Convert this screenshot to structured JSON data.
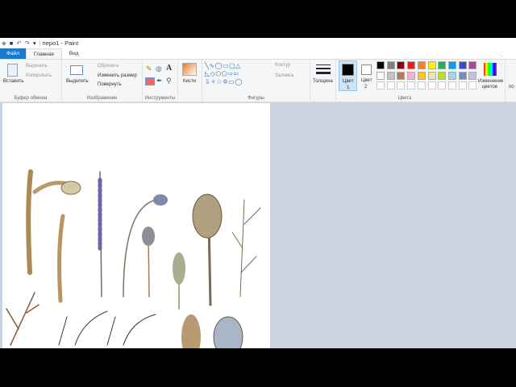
{
  "title": "перо1 - Paint",
  "tabs": [
    "Файл",
    "Главная",
    "Вид"
  ],
  "clipboard": {
    "paste": "Вставить",
    "cut": "Вырезать",
    "copy": "Копировать",
    "label": "Буфер обмена"
  },
  "image": {
    "select": "Выделить",
    "crop": "Обрезать",
    "resize": "Изменить размер",
    "rotate": "Повернуть",
    "label": "Изображение"
  },
  "tools": {
    "label": "Инструменты"
  },
  "brushes": {
    "label": "Кисти"
  },
  "shapes": {
    "outline": "Контур",
    "fill": "Заливка",
    "label": "Фигуры"
  },
  "size": {
    "label": "Толщина"
  },
  "colors": {
    "color1": "Цвет",
    "color1_num": "1",
    "color2": "Цвет",
    "color2_num": "2",
    "label": "Цвета",
    "edit": "Изменение",
    "edit2": "цветов",
    "cut_off": "по",
    "row1": [
      "#000000",
      "#7f7f7f",
      "#880015",
      "#ed1c24",
      "#ff7f27",
      "#fff200",
      "#22b14c",
      "#00a2e8",
      "#3f48cc",
      "#a349a4"
    ],
    "row2": [
      "#ffffff",
      "#c3c3c3",
      "#b97a57",
      "#ffaec9",
      "#ffc90e",
      "#efe4b0",
      "#b5e61d",
      "#99d9ea",
      "#7092be",
      "#c8bfe7"
    ]
  }
}
